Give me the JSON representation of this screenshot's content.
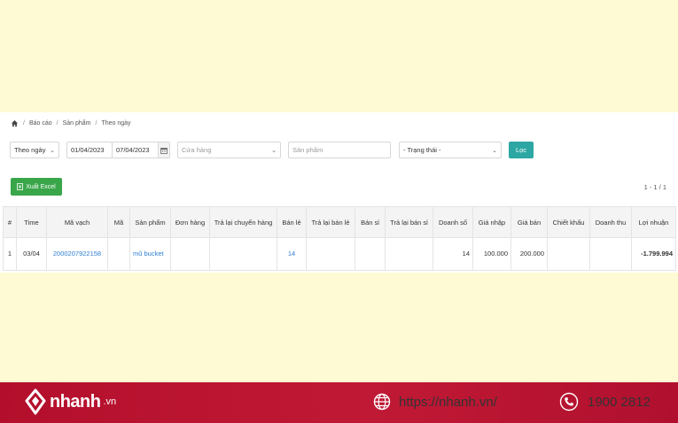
{
  "breadcrumb": {
    "items": [
      "Báo cáo",
      "Sản phẩm",
      "Theo ngày"
    ],
    "separator": "/"
  },
  "filters": {
    "mode": "Theo ngày",
    "date_from": "01/04/2023",
    "date_to": "07/04/2023",
    "store_placeholder": "Cửa hàng",
    "product_placeholder": "Sản phẩm",
    "status_placeholder": "- Trạng thái -",
    "filter_button": "Lọc"
  },
  "toolbar": {
    "export_label": "Xuất Excel",
    "pagination": "1 - 1 / 1"
  },
  "table": {
    "headers": {
      "index": "#",
      "time": "Time",
      "barcode": "Mã vạch",
      "code": "Mã",
      "product": "Sản phẩm",
      "orders": "Đơn hàng",
      "transfer_return": "Trả lại chuyển hàng",
      "retail": "Bán lẻ",
      "retail_return": "Trả lại bán lẻ",
      "wholesale": "Bán sỉ",
      "wholesale_return": "Trả lại bán sỉ",
      "revenue": "Doanh số",
      "cost_price": "Giá nhập",
      "sale_price": "Giá bán",
      "discount": "Chiết khấu",
      "net_revenue": "Doanh thu",
      "profit": "Lợi nhuận"
    },
    "rows": [
      {
        "index": "1",
        "time": "03/04",
        "barcode": "2000207922158",
        "code": "",
        "product": "mũ bucket",
        "orders": "",
        "transfer_return": "",
        "retail": "14",
        "retail_return": "",
        "wholesale": "",
        "wholesale_return": "",
        "revenue": "14",
        "cost_price": "100.000",
        "sale_price": "200.000",
        "discount": "",
        "net_revenue": "",
        "profit": "-1.799.994"
      }
    ]
  },
  "footer": {
    "brand": "nhanh",
    "brand_suffix": ".vn",
    "website": "https://nhanh.vn/",
    "hotline": "1900 2812"
  },
  "colors": {
    "filter_button": "#2ca7a3",
    "export_button": "#3aa64a",
    "footer": "#b8132f",
    "link": "#2f7fd0",
    "background": "#fefbd4"
  }
}
